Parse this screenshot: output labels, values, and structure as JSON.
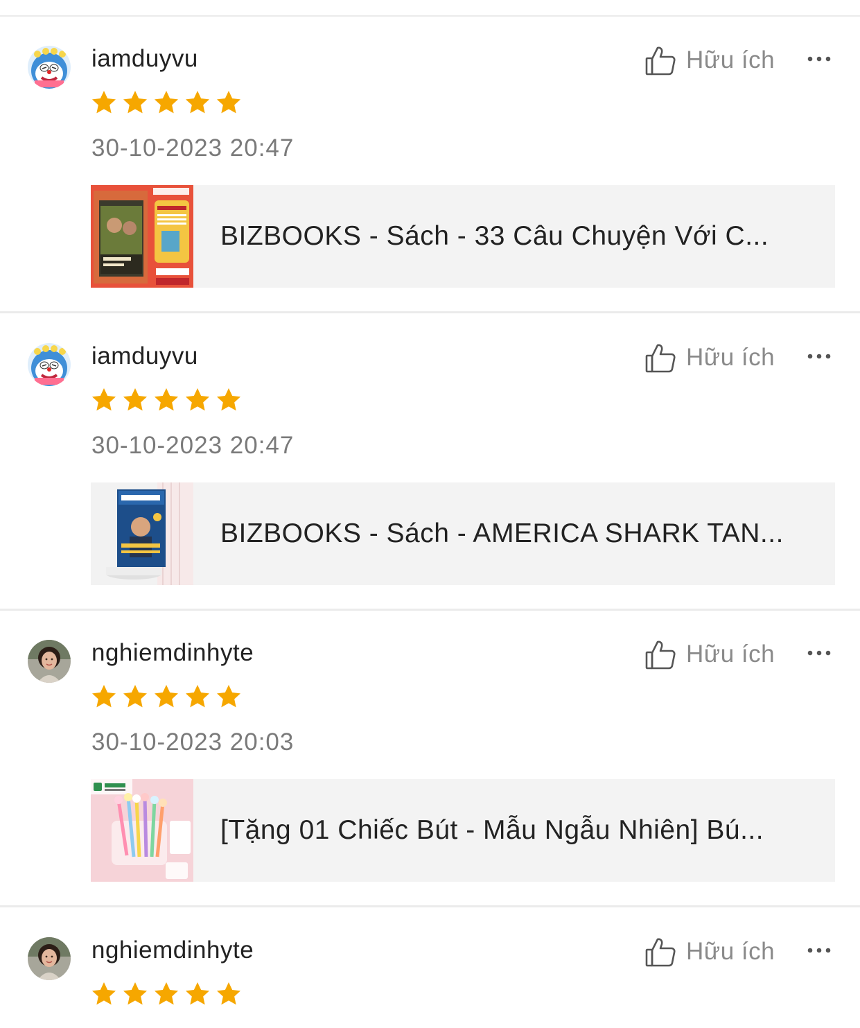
{
  "reviews": [
    {
      "username": "iamduyvu",
      "rating": 5,
      "datetime": "30-10-2023 20:47",
      "helpful_label": "Hữu ích",
      "avatar": "cartoon-cat-avatar",
      "product": {
        "title": "BIZBOOKS - Sách - 33 Câu Chuyện Với C..."
      }
    },
    {
      "username": "iamduyvu",
      "rating": 5,
      "datetime": "30-10-2023 20:47",
      "helpful_label": "Hữu ích",
      "avatar": "cartoon-cat-avatar",
      "product": {
        "title": "BIZBOOKS - Sách - AMERICA SHARK TAN..."
      }
    },
    {
      "username": "nghiemdinhyte",
      "rating": 5,
      "datetime": "30-10-2023 20:03",
      "helpful_label": "Hữu ích",
      "avatar": "photo-avatar",
      "product": {
        "title": "[Tặng  01 Chiếc Bút - Mẫu Ngẫu Nhiên] Bú..."
      }
    },
    {
      "username": "nghiemdinhyte",
      "rating": 5,
      "helpful_label": "Hữu ích",
      "avatar": "photo-avatar"
    }
  ],
  "colors": {
    "star": "#f6a700",
    "divider": "#ebebeb",
    "card_background": "#f3f3f3",
    "muted_text": "#8a8a8a"
  },
  "icons": {
    "helpful": "thumbs-up-icon",
    "more": "more-dots-icon",
    "star": "star-icon"
  }
}
